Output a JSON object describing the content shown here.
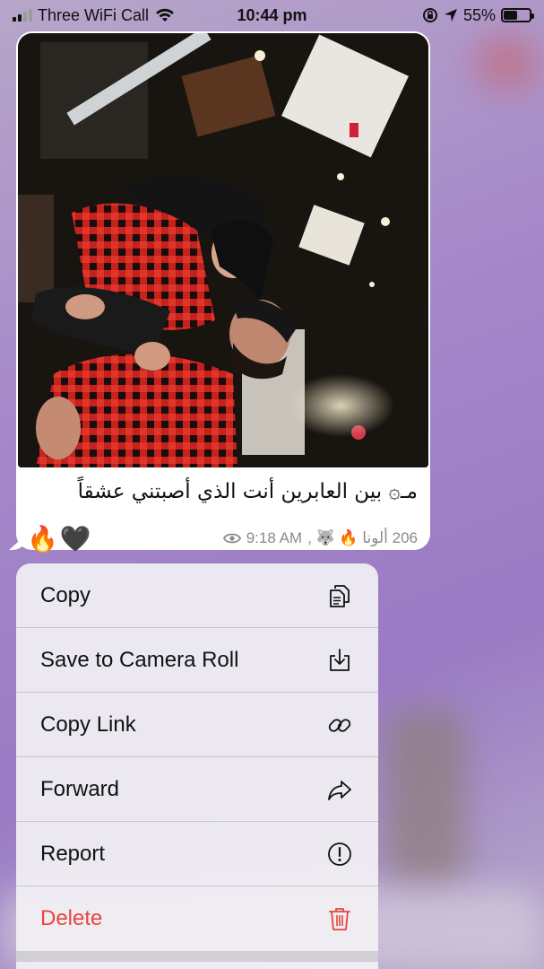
{
  "status_bar": {
    "carrier": "Three WiFi Call",
    "time": "10:44 pm",
    "battery": "55%",
    "battery_level": 0.55
  },
  "message": {
    "caption": "مـ۞ بين العابرين أنت الذي أصبتني عشقاً",
    "reactions": [
      "🔥",
      "🖤"
    ],
    "time": "9:18 AM",
    "signature": "206 ألونا 🔥 🐺 ,",
    "views_icon": "eye-icon"
  },
  "menu": {
    "items": [
      {
        "label": "Copy",
        "icon": "copy-icon"
      },
      {
        "label": "Save to Camera Roll",
        "icon": "save-icon"
      },
      {
        "label": "Copy Link",
        "icon": "link-icon"
      },
      {
        "label": "Forward",
        "icon": "forward-icon"
      },
      {
        "label": "Report",
        "icon": "report-icon"
      },
      {
        "label": "Delete",
        "icon": "trash-icon",
        "color": "#e5453d"
      }
    ]
  }
}
